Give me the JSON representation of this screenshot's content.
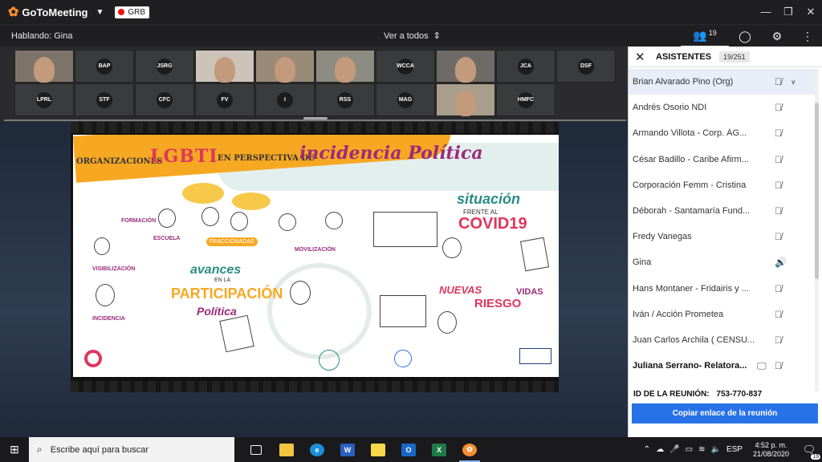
{
  "titlebar": {
    "brand": "GoToMeeting",
    "country_code": "GRB",
    "controls": [
      "—",
      "❐",
      "✕"
    ]
  },
  "topbar": {
    "speaking": "Hablando: Gina",
    "view_all": "Ver a todos",
    "attendee_count": "19"
  },
  "tiles": [
    {
      "type": "cam"
    },
    {
      "type": "initials",
      "label": "BAP"
    },
    {
      "type": "initials",
      "label": "JSRG"
    },
    {
      "type": "cam"
    },
    {
      "type": "cam"
    },
    {
      "type": "cam"
    },
    {
      "type": "initials",
      "label": "WCCA"
    },
    {
      "type": "cam"
    },
    {
      "type": "initials",
      "label": "JCA"
    },
    {
      "type": "initials",
      "label": "DSF"
    },
    {
      "type": "initials",
      "label": "LPRL"
    },
    {
      "type": "initials",
      "label": "STF"
    },
    {
      "type": "initials",
      "label": "CFC"
    },
    {
      "type": "initials",
      "label": "FV"
    },
    {
      "type": "initials",
      "label": "I"
    },
    {
      "type": "initials",
      "label": "RSS"
    },
    {
      "type": "initials",
      "label": "MAG"
    },
    {
      "type": "cam"
    },
    {
      "type": "initials",
      "label": "HMFC"
    }
  ],
  "slide": {
    "org": "ORGANIZACIONES",
    "lgbti": "LGBTI",
    "persp": "EN PERSPECTIVA DE",
    "incidencia": "incidencia Política",
    "situacion": "situación",
    "frente": "FRENTE AL",
    "covid": "COVID19",
    "avances": "avances",
    "en_la": "EN LA",
    "participacion": "PARTICIPACIÓN",
    "politica": "Política",
    "nuevas": "NUEVAS",
    "vidas": "VIDAS",
    "riesgo": "RIESGO",
    "formacion": "FORMACIÓN",
    "escuela": "ESCUELA",
    "movilizacion": "MOVILIZACIÓN",
    "visibilizacion": "VISIBILIZACIÓN",
    "incidencia_small": "INCIDENCIA",
    "fraccionadas": "FRACCIONADAS"
  },
  "sidebar": {
    "title": "ASISTENTES",
    "count": "19/251",
    "participants": [
      {
        "name": "Brian Alvarado Pino  (Org)",
        "selected": true,
        "bold": false
      },
      {
        "name": "Andrés Osorio NDI"
      },
      {
        "name": "Armando Villota - Corp. ÁG..."
      },
      {
        "name": "César Badillo - Caribe Afirm..."
      },
      {
        "name": "Corporación Femm - Cristina"
      },
      {
        "name": "Déborah - Santamaría Fund..."
      },
      {
        "name": "Fredy Vanegas"
      },
      {
        "name": "Gina",
        "speaking": true
      },
      {
        "name": "Hans Montaner - Fridairis y ..."
      },
      {
        "name": "Iván / Acción Prometea"
      },
      {
        "name": "Juan Carlos Archila ( CENSU..."
      },
      {
        "name": "Juliana Serrano- Relatora...",
        "bold": true,
        "screen": true
      }
    ],
    "meeting_id_label": "ID DE LA REUNIÓN:",
    "meeting_id": "753-770-837",
    "copy_link": "Copiar enlace de la reunión"
  },
  "taskbar": {
    "search_placeholder": "Escribe aquí para buscar",
    "lang": "ESP",
    "time": "4:52 p. m.",
    "date": "21/08/2020",
    "notifications": "19"
  },
  "colors": {
    "accent_blue": "#2872e9",
    "brand_orange": "#f68d2e",
    "slide_pink": "#e0365c",
    "slide_orange": "#f7a822",
    "slide_teal": "#2a8d87"
  }
}
